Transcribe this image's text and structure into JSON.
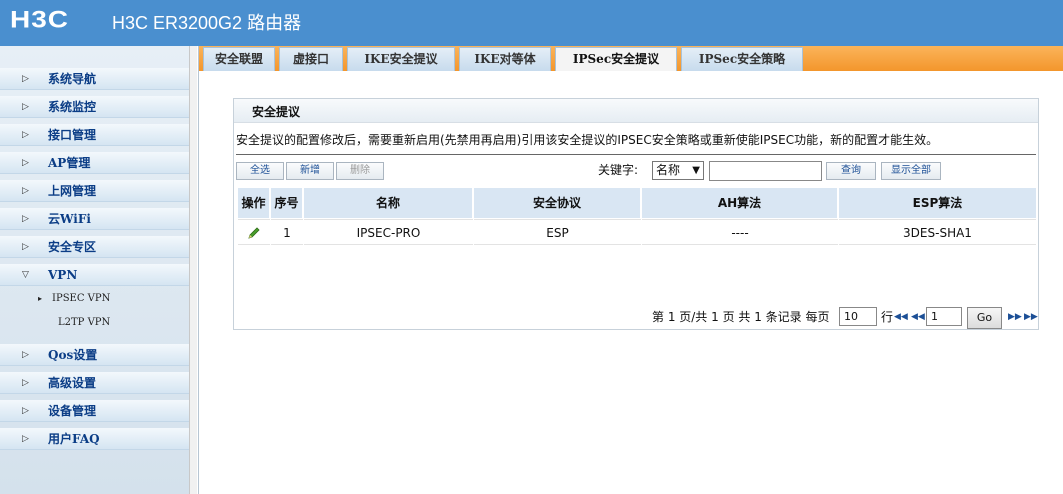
{
  "header": {
    "logo": "H3C",
    "title": "H3C ER3200G2 路由器"
  },
  "sidebar": {
    "items": [
      {
        "label": "系统导航"
      },
      {
        "label": "系统监控"
      },
      {
        "label": "接口管理"
      },
      {
        "label": "AP管理"
      },
      {
        "label": "上网管理"
      },
      {
        "label": "云WiFi"
      },
      {
        "label": "安全专区"
      },
      {
        "label": "VPN"
      },
      {
        "label": "Qos设置"
      },
      {
        "label": "高级设置"
      },
      {
        "label": "设备管理"
      },
      {
        "label": "用户FAQ"
      }
    ],
    "vpn_sub": [
      {
        "label": "IPSEC VPN"
      },
      {
        "label": "L2TP VPN"
      }
    ]
  },
  "tabs": [
    {
      "label": "安全联盟"
    },
    {
      "label": "虚接口"
    },
    {
      "label": "IKE安全提议"
    },
    {
      "label": "IKE对等体"
    },
    {
      "label": "IPSec安全提议"
    },
    {
      "label": "IPSec安全策略"
    }
  ],
  "panel": {
    "title": "安全提议",
    "notice": "安全提议的配置修改后，需要重新启用(先禁用再启用)引用该安全提议的IPSEC安全策略或重新使能IPSEC功能，新的配置才能生效。",
    "buttons": {
      "select_all": "全选",
      "add": "新增",
      "delete": "删除",
      "search": "查询",
      "show_all": "显示全部"
    },
    "keyword_label": "关键字:",
    "keyword_select": "名称"
  },
  "table": {
    "headers": [
      "操作",
      "序号",
      "名称",
      "安全协议",
      "AH算法",
      "ESP算法"
    ],
    "rows": [
      {
        "index": "1",
        "name": "IPSEC-PRO",
        "protocol": "ESP",
        "ah": "----",
        "esp": "3DES-SHA1"
      }
    ]
  },
  "pager": {
    "text1": "第 1 页/共 1 页 共 1 条记录 每页",
    "per_page": "10",
    "text2": "行",
    "page": "1",
    "go": "Go"
  },
  "colors": {
    "header_bg": "#4a8fcf",
    "tabbar_bg": "#f3962c",
    "sidebar_text": "#0b3d86",
    "table_header_bg": "#d9e6f3"
  }
}
